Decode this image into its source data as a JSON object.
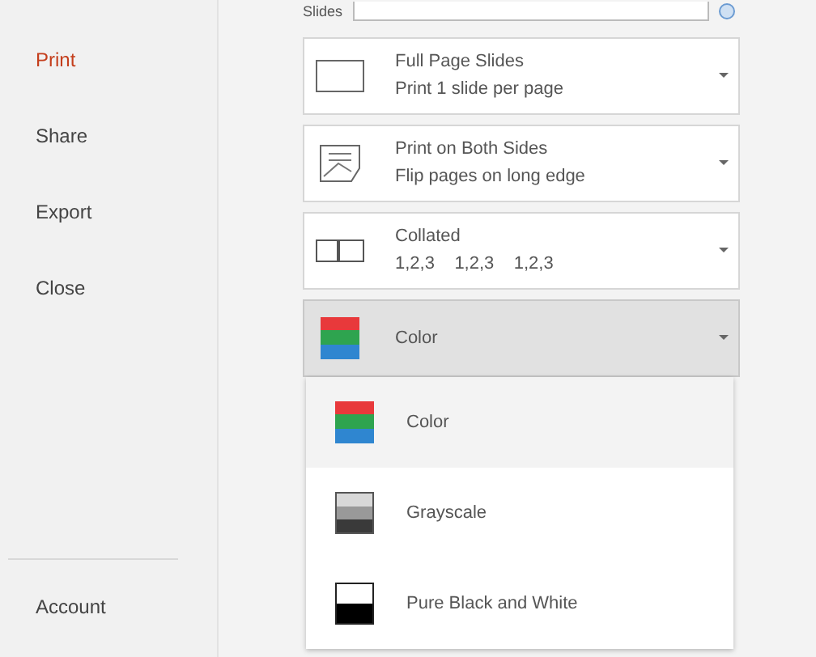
{
  "sidebar": {
    "items": [
      {
        "label": "Print",
        "selected": true
      },
      {
        "label": "Share",
        "selected": false
      },
      {
        "label": "Export",
        "selected": false
      },
      {
        "label": "Close",
        "selected": false
      }
    ],
    "footer_items": [
      {
        "label": "Account",
        "selected": false
      }
    ]
  },
  "slides_field": {
    "label": "Slides"
  },
  "settings": [
    {
      "kind": "full-page",
      "title": "Full Page Slides",
      "subtitle": "Print 1 slide per page",
      "expanded": false
    },
    {
      "kind": "duplex",
      "title": "Print on Both Sides",
      "subtitle": "Flip pages on long edge",
      "expanded": false
    },
    {
      "kind": "collated",
      "title": "Collated",
      "subtitle": "1,2,3    1,2,3    1,2,3",
      "expanded": false
    },
    {
      "kind": "color",
      "title": "Color",
      "expanded": true
    }
  ],
  "color_menu": [
    {
      "kind": "color",
      "label": "Color",
      "selected": true
    },
    {
      "kind": "grayscale",
      "label": "Grayscale",
      "selected": false
    },
    {
      "kind": "bw",
      "label": "Pure Black and White",
      "selected": false
    }
  ]
}
